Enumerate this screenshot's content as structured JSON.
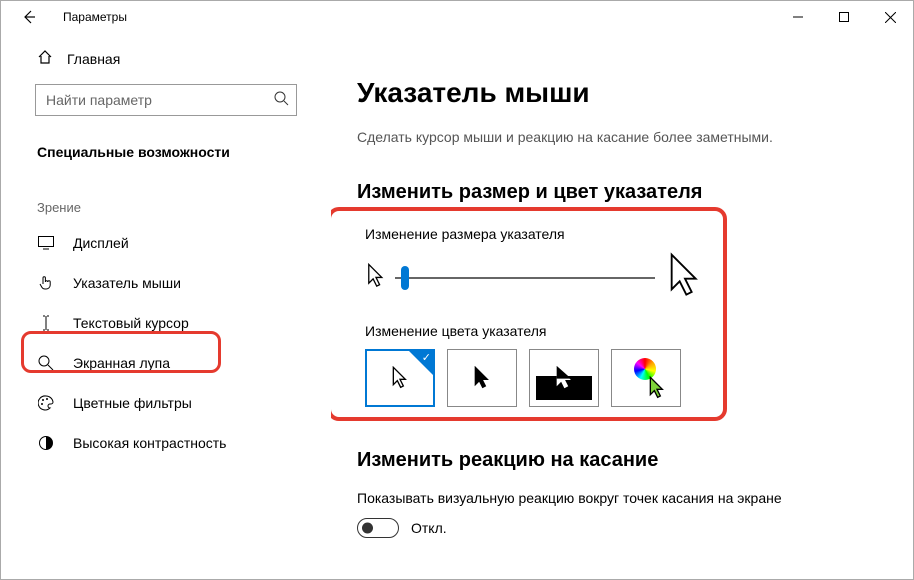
{
  "titlebar": {
    "title": "Параметры"
  },
  "sidebar": {
    "home": "Главная",
    "search_placeholder": "Найти параметр",
    "section": "Специальные возможности",
    "category": "Зрение",
    "items": [
      {
        "label": "Дисплей"
      },
      {
        "label": "Указатель мыши"
      },
      {
        "label": "Текстовый курсор"
      },
      {
        "label": "Экранная лупа"
      },
      {
        "label": "Цветные фильтры"
      },
      {
        "label": "Высокая контрастность"
      }
    ]
  },
  "content": {
    "h1": "Указатель мыши",
    "desc": "Сделать курсор мыши и реакцию на касание более заметными.",
    "h2a": "Изменить размер и цвет указателя",
    "size_label": "Изменение размера указателя",
    "color_label": "Изменение цвета указателя",
    "h2b": "Изменить реакцию на касание",
    "touch_label": "Показывать визуальную реакцию вокруг точек касания на экране",
    "toggle_state": "Откл."
  }
}
